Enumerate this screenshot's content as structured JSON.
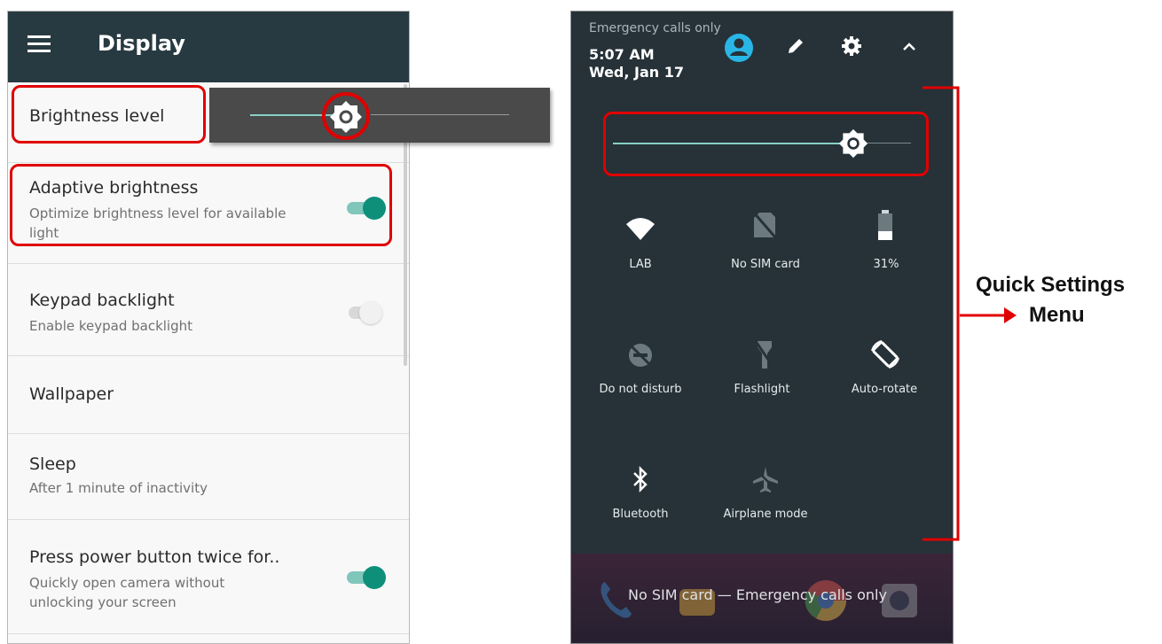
{
  "left_screen": {
    "title": "Display",
    "items": [
      {
        "title": "Brightness level",
        "subtitle": ""
      },
      {
        "title": "Adaptive brightness",
        "subtitle": "Optimize brightness level for available light",
        "toggle": "on"
      },
      {
        "title": "Keypad backlight",
        "subtitle": "Enable keypad backlight",
        "toggle": "off"
      },
      {
        "title": "Wallpaper",
        "subtitle": ""
      },
      {
        "title": "Sleep",
        "subtitle": "After 1 minute of inactivity"
      },
      {
        "title": "Press power button twice for..",
        "subtitle": "Quickly open camera without unlocking your screen",
        "toggle": "on"
      }
    ],
    "brightness_popup_level": 0.4
  },
  "right_screen": {
    "status": {
      "network": "Emergency calls only",
      "time": "5:07 AM",
      "date": "Wed, Jan 17"
    },
    "brightness_slider_level": 0.8,
    "tiles": [
      {
        "label": "LAB",
        "icon": "wifi-icon"
      },
      {
        "label": "No SIM card",
        "icon": "no-sim-icon"
      },
      {
        "label": "31%",
        "icon": "battery-icon"
      },
      {
        "label": "Do not disturb",
        "icon": "do-not-disturb-icon"
      },
      {
        "label": "Flashlight",
        "icon": "flashlight-icon"
      },
      {
        "label": "Auto-rotate",
        "icon": "auto-rotate-icon"
      },
      {
        "label": "Bluetooth",
        "icon": "bluetooth-icon"
      },
      {
        "label": "Airplane mode",
        "icon": "airplane-icon"
      }
    ],
    "lockscreen_text": "No SIM card — Emergency calls only"
  },
  "annotation": {
    "line1": "Quick Settings",
    "line2": "Menu"
  },
  "colors": {
    "accent": "#0e8f7a",
    "highlight": "#e00000",
    "appbar": "#283a41",
    "panel": "#263238"
  }
}
